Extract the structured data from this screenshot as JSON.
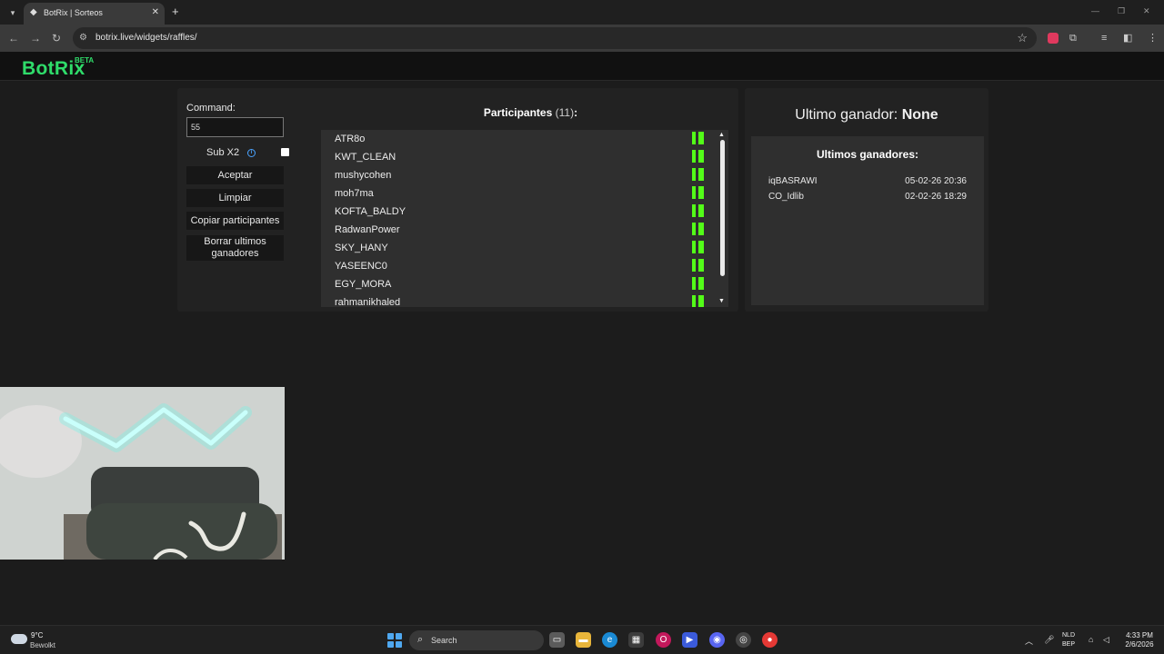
{
  "browser": {
    "tab_title": "BotRix | Sorteos",
    "url": "botrix.live/widgets/raffles/"
  },
  "header": {
    "logo": "BotRix",
    "badge": "BETA"
  },
  "controls": {
    "command_label": "Command:",
    "command_value": "55",
    "sub_label": "Sub X2",
    "sub_checked": false,
    "accept_label": "Aceptar",
    "clear_label": "Limpiar",
    "copy_label": "Copiar participantes",
    "delete_label": "Borrar ultimos ganadores"
  },
  "participants": {
    "title": "Participantes",
    "count_text": "(11)",
    "colon": ":",
    "items": [
      {
        "name": "ATR8o"
      },
      {
        "name": "KWT_CLEAN"
      },
      {
        "name": "mushycohen"
      },
      {
        "name": "moh7ma"
      },
      {
        "name": "KOFTA_BALDY"
      },
      {
        "name": "RadwanPower"
      },
      {
        "name": "SKY_HANY"
      },
      {
        "name": "YASEENC0"
      },
      {
        "name": "EGY_MORA"
      },
      {
        "name": "rahmanikhaled"
      }
    ]
  },
  "winner": {
    "label": "Ultimo ganador:",
    "value": "None",
    "recent_title": "Ultimos ganadores:",
    "recent": [
      {
        "name": "iqBASRAWI",
        "date": "05-02-26 20:36"
      },
      {
        "name": "CO_Idlib",
        "date": "02-02-26 18:29"
      }
    ]
  },
  "taskbar": {
    "temperature": "9°C",
    "weather": "Bewolkt",
    "search_label": "Search",
    "lang_top": "NLD",
    "lang_bottom": "BEP",
    "time": "4:33 PM",
    "date": "2/6/2026"
  },
  "colors": {
    "brand": "#2fdc6a",
    "kick_green": "#53fc18",
    "info_blue": "#4aa3ff"
  }
}
